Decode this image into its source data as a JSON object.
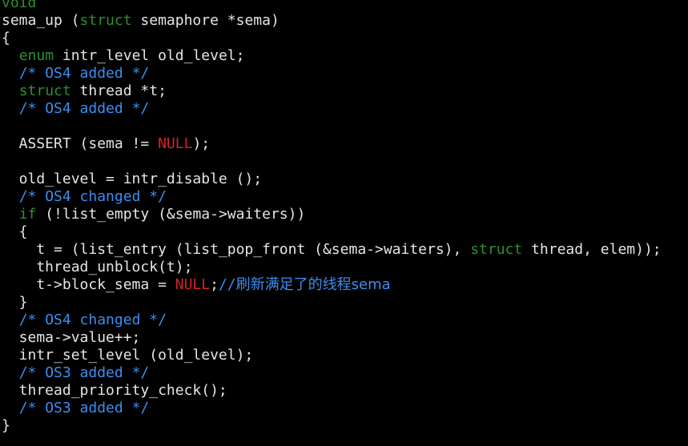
{
  "colors": {
    "background": "#000000",
    "text": "#e5e5e5",
    "keyword": "#2f8f2f",
    "comment": "#3b8ef0",
    "constant": "#d42424"
  },
  "lines": [
    [
      {
        "t": "void",
        "c": "keyword"
      }
    ],
    [
      {
        "t": "sema_up (",
        "c": "text"
      },
      {
        "t": "struct",
        "c": "keyword"
      },
      {
        "t": " semaphore *sema)",
        "c": "text"
      }
    ],
    [
      {
        "t": "{",
        "c": "text"
      }
    ],
    [
      {
        "t": "  ",
        "c": "text"
      },
      {
        "t": "enum",
        "c": "keyword"
      },
      {
        "t": " intr_level old_level;",
        "c": "text"
      }
    ],
    [
      {
        "t": "  ",
        "c": "text"
      },
      {
        "t": "/* OS4 added */",
        "c": "comment"
      }
    ],
    [
      {
        "t": "  ",
        "c": "text"
      },
      {
        "t": "struct",
        "c": "keyword"
      },
      {
        "t": " thread *t;",
        "c": "text"
      }
    ],
    [
      {
        "t": "  ",
        "c": "text"
      },
      {
        "t": "/* OS4 added */",
        "c": "comment"
      }
    ],
    [],
    [
      {
        "t": "  ASSERT (sema != ",
        "c": "text"
      },
      {
        "t": "NULL",
        "c": "constant"
      },
      {
        "t": ");",
        "c": "text"
      }
    ],
    [],
    [
      {
        "t": "  old_level = intr_disable ();",
        "c": "text"
      }
    ],
    [
      {
        "t": "  ",
        "c": "text"
      },
      {
        "t": "/* OS4 changed */",
        "c": "comment"
      }
    ],
    [
      {
        "t": "  ",
        "c": "text"
      },
      {
        "t": "if",
        "c": "keyword"
      },
      {
        "t": " (!list_empty (&sema->waiters))",
        "c": "text"
      }
    ],
    [
      {
        "t": "  {",
        "c": "text"
      }
    ],
    [
      {
        "t": "    t = (list_entry (list_pop_front (&sema->waiters), ",
        "c": "text"
      },
      {
        "t": "struct",
        "c": "keyword"
      },
      {
        "t": " thread, elem));",
        "c": "text"
      }
    ],
    [
      {
        "t": "    thread_unblock(t);",
        "c": "text"
      }
    ],
    [
      {
        "t": "    t->block_sema = ",
        "c": "text"
      },
      {
        "t": "NULL",
        "c": "constant"
      },
      {
        "t": ";",
        "c": "text"
      },
      {
        "t": "//",
        "c": "comment"
      },
      {
        "t": "刷新满足了的线程",
        "c": "comment",
        "cjk": true
      },
      {
        "t": "sema",
        "c": "comment",
        "cjk": true
      }
    ],
    [
      {
        "t": "  }",
        "c": "text"
      }
    ],
    [
      {
        "t": "  ",
        "c": "text"
      },
      {
        "t": "/* OS4 changed */",
        "c": "comment"
      }
    ],
    [
      {
        "t": "  sema->value++;",
        "c": "text"
      }
    ],
    [
      {
        "t": "  intr_set_level (old_level);",
        "c": "text"
      }
    ],
    [
      {
        "t": "  ",
        "c": "text"
      },
      {
        "t": "/* OS3 added */",
        "c": "comment"
      }
    ],
    [
      {
        "t": "  thread_priority_check();",
        "c": "text"
      }
    ],
    [
      {
        "t": "  ",
        "c": "text"
      },
      {
        "t": "/* OS3 added */",
        "c": "comment"
      }
    ],
    [
      {
        "t": "}",
        "c": "text"
      }
    ]
  ]
}
